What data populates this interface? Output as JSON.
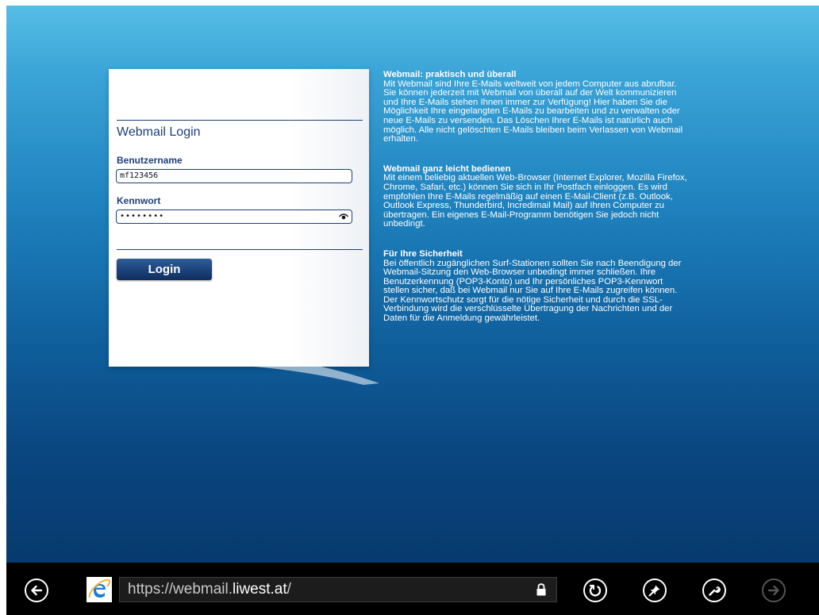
{
  "login": {
    "title": "Webmail Login",
    "username_label": "Benutzername",
    "username_value": "mf123456",
    "password_label": "Kennwort",
    "password_value": "••••••••",
    "login_button": "Login"
  },
  "info": {
    "sections": [
      {
        "heading": "Webmail: praktisch und überall",
        "body": "Mit Webmail sind Ihre E-Mails weltweit von jedem Computer aus abrufbar. Sie können jederzeit mit Webmail von überall auf der Welt kommunizieren und Ihre E-Mails stehen Ihnen immer zur Verfügung! Hier haben Sie die Möglichkeit Ihre eingelangten E-Mails zu bearbeiten und zu verwalten oder neue E-Mails zu versenden. Das Löschen Ihrer E-Mails ist natürlich auch möglich. Alle nicht gelöschten E-Mails bleiben beim Verlassen von Webmail erhalten."
      },
      {
        "heading": "Webmail ganz leicht bedienen",
        "body": "Mit einem beliebig aktuellen Web-Browser (Internet Explorer, Mozilla Firefox, Chrome, Safari, etc.) können Sie sich in Ihr Postfach einloggen. Es wird empfohlen Ihre E-Mails regelmäßig auf einen E-Mail-Client (z.B. Outlook, Outlook Express, Thunderbird, Incredimail Mail) auf Ihren Computer zu übertragen. Ein eigenes E-Mail-Programm benötigen Sie jedoch nicht unbedingt."
      },
      {
        "heading": "Für Ihre Sicherheit",
        "body": "Bei öffentlich zugänglichen Surf-Stationen sollten Sie nach Beendigung der Webmail-Sitzung den Web-Browser unbedingt immer schließen. Ihre Benutzerkennung (POP3-Konto) und Ihr persönliches POP3-Kennwort stellen sicher, daß bei Webmail nur Sie auf Ihre E-Mails zugreifen können. Der Kennwortschutz sorgt für die nötige Sicherheit und durch die SSL-Verbindung wird die verschlüsselte Übertragung der Nachrichten und der Daten für die Anmeldung gewährleistet."
      }
    ]
  },
  "browser": {
    "url_prefix": "https://webmail.",
    "url_domain": "liwest.at",
    "url_suffix": "/",
    "icons": [
      "back-icon",
      "internet-explorer-logo",
      "lock-icon",
      "refresh-icon",
      "pin-icon",
      "tools-icon",
      "forward-icon"
    ]
  },
  "colors": {
    "brand_navy": "#1d3f7a",
    "sky_top": "#56bde6",
    "sky_bottom": "#073a6e",
    "appbar": "#000000"
  }
}
